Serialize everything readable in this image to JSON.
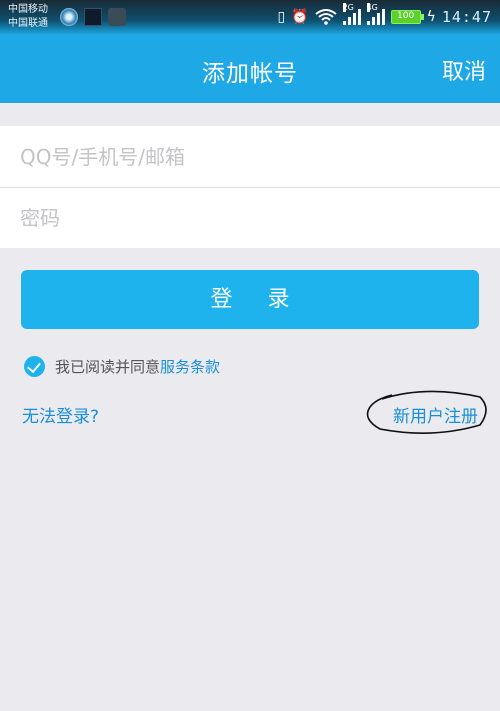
{
  "status_bar": {
    "carrier_1": "中国移动",
    "carrier_2": "中国联通",
    "net_label_1": "2G",
    "net_label_2": "4G",
    "battery": "100",
    "time": "14:47"
  },
  "header": {
    "title": "添加帐号",
    "cancel_label": "取消"
  },
  "form": {
    "account_placeholder": "QQ号/手机号/邮箱",
    "password_placeholder": "密码"
  },
  "login_button": "登 录",
  "agreement": {
    "text": "我已阅读并同意",
    "link": "服务条款"
  },
  "links": {
    "cant_login": "无法登录?",
    "new_user": "新用户注册"
  },
  "colors": {
    "accent": "#1ea9e6",
    "button": "#1fb3ee",
    "link": "#1a8fd6",
    "background": "#ebebef"
  }
}
